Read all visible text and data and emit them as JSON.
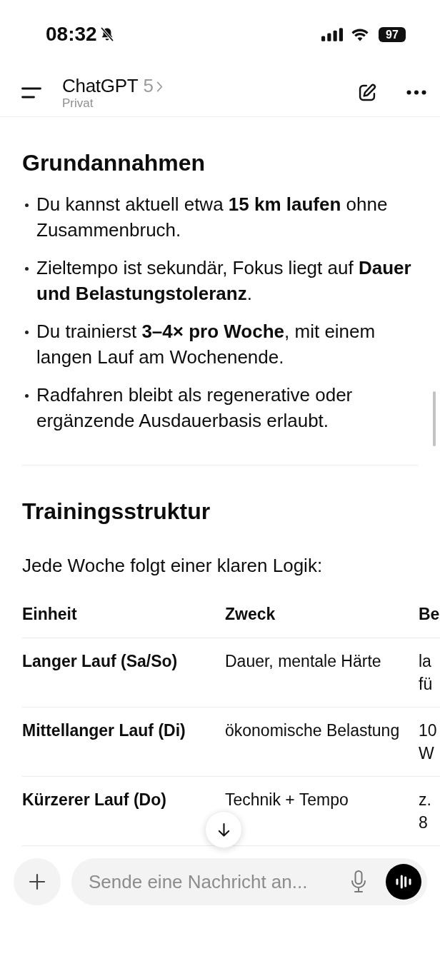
{
  "status_bar": {
    "time": "08:32",
    "battery": "97"
  },
  "header": {
    "title": "ChatGPT",
    "model": "5",
    "subtitle": "Privat"
  },
  "sections": [
    {
      "heading": "Grundannahmen",
      "bullets": [
        "Du kannst aktuell etwa **15 km laufen** ohne Zusammenbruch.",
        "Zieltempo ist sekundär, Fokus liegt auf **Dauer und Belastungstoleranz**.",
        "Du trainierst **3–4× pro Woche**, mit einem langen Lauf am Wochenende.",
        "Radfahren bleibt als regenerative oder ergänzende Ausdauerbasis erlaubt."
      ]
    },
    {
      "heading": "Trainingsstruktur",
      "intro": "Jede Woche folgt einer klaren Logik:",
      "table": {
        "columns": [
          "Einheit",
          "Zweck",
          "Be"
        ],
        "rows": [
          [
            "Langer Lauf (Sa/So)",
            "Dauer, mentale Härte",
            "la\nfü"
          ],
          [
            "Mittellanger Lauf (Di)",
            "ökonomische Belastung",
            "10\nW"
          ],
          [
            "Kürzerer Lauf (Do)",
            "Technik + Tempo",
            "z.\n8"
          ]
        ]
      }
    }
  ],
  "composer": {
    "placeholder": "Sende eine Nachricht an..."
  }
}
